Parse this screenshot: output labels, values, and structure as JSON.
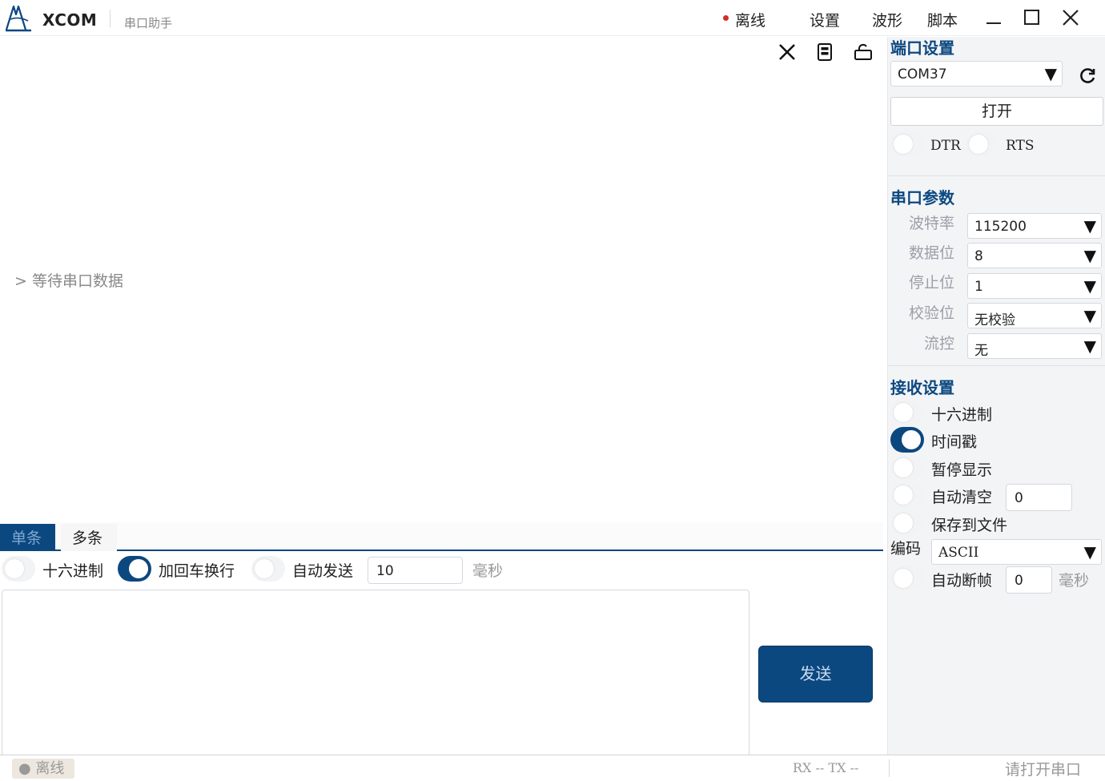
{
  "titlebar": {
    "app_title": "XCOM",
    "app_subtitle": "串口助手",
    "status_text": "离线",
    "status_color": "#d22b2b",
    "menu": {
      "settings": "设置",
      "waveform": "波形",
      "script": "脚本"
    }
  },
  "receive": {
    "placeholder": "> 等待串口数据",
    "tools": [
      "clear-icon",
      "save-icon",
      "lock-icon"
    ]
  },
  "send": {
    "tabs": {
      "single": "单条",
      "multi": "多条"
    },
    "active_tab": "single",
    "hex_label": "十六进制",
    "hex_on": false,
    "crlf_label": "加回车换行",
    "crlf_on": true,
    "auto_send_label": "自动发送",
    "auto_send_on": false,
    "interval_value": "10",
    "interval_unit": "毫秒",
    "text_value": "",
    "send_label": "发送"
  },
  "port": {
    "section_title": "端口设置",
    "selected_port": "COM37",
    "open_label": "打开",
    "dtr_label": "DTR",
    "dtr_on": false,
    "rts_label": "RTS",
    "rts_on": false
  },
  "params": {
    "section_title": "串口参数",
    "baud_label": "波特率",
    "baud_value": "115200",
    "databits_label": "数据位",
    "databits_value": "8",
    "stopbits_label": "停止位",
    "stopbits_value": "1",
    "parity_label": "校验位",
    "parity_value": "无校验",
    "flow_label": "流控",
    "flow_value": "无"
  },
  "recv_settings": {
    "section_title": "接收设置",
    "hex_label": "十六进制",
    "hex_on": false,
    "timestamp_label": "时间戳",
    "timestamp_on": true,
    "pause_label": "暂停显示",
    "pause_on": false,
    "auto_clear_label": "自动清空",
    "auto_clear_on": false,
    "auto_clear_value": "0",
    "save_file_label": "保存到文件",
    "save_file_on": false,
    "encoding_label": "编码",
    "encoding_value": "ASCII",
    "auto_frame_label": "自动断帧",
    "auto_frame_on": false,
    "auto_frame_value": "0",
    "auto_frame_unit": "毫秒"
  },
  "statusbar": {
    "offline_label": "● 离线",
    "rxtx": "RX --   TX --",
    "port_status": "请打开串口"
  },
  "colors": {
    "accent": "#0c4880",
    "panel_bg": "#f3f4f6"
  }
}
